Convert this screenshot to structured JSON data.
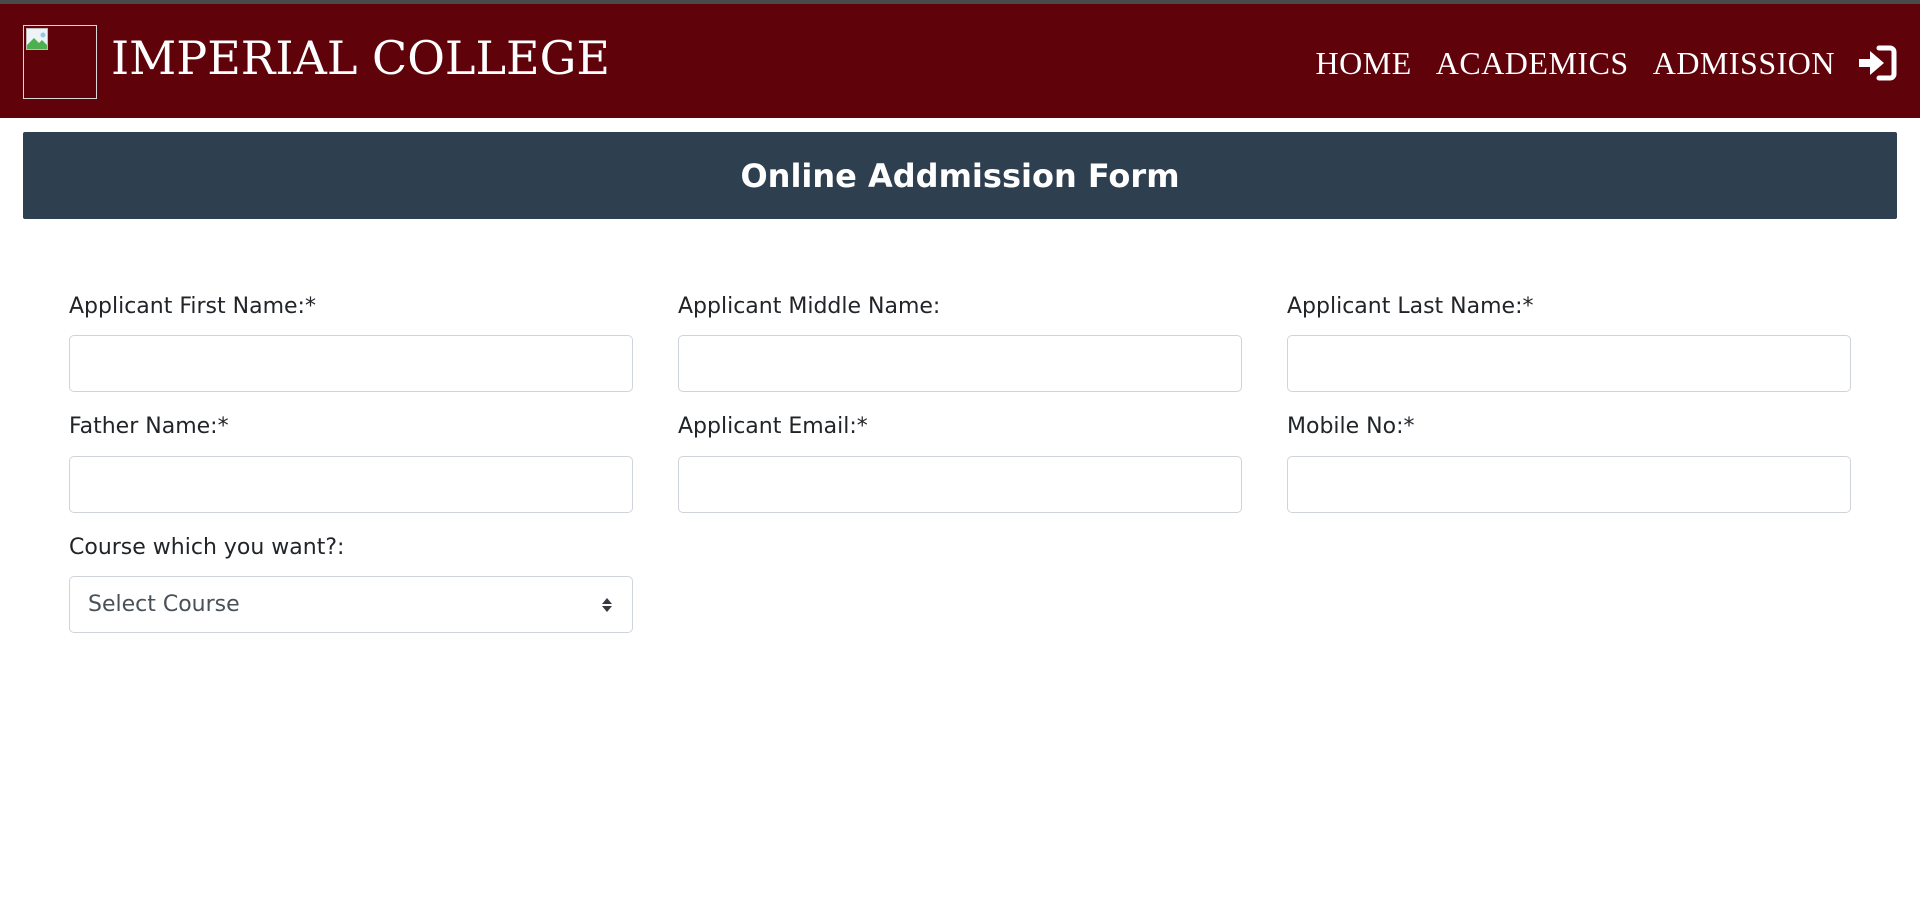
{
  "navbar": {
    "brand": "IMPERIAL COLLEGE",
    "links": [
      "HOME",
      "ACADEMICS",
      "ADMISSION"
    ],
    "login_icon": "sign-in-icon",
    "logo_icon": "broken-image-icon",
    "background": "#5f020a"
  },
  "form": {
    "title": "Online Addmission Form",
    "header_color": "#2e3f50",
    "fields": {
      "first_name": {
        "label": "Applicant First Name:*",
        "value": ""
      },
      "middle_name": {
        "label": "Applicant Middle Name:",
        "value": ""
      },
      "last_name": {
        "label": "Applicant Last Name:*",
        "value": ""
      },
      "father_name": {
        "label": "Father Name:*",
        "value": ""
      },
      "email": {
        "label": "Applicant Email:*",
        "value": ""
      },
      "mobile": {
        "label": "Mobile No:*",
        "value": ""
      },
      "course": {
        "label": "Course which you want?:",
        "selected": "Select Course"
      }
    }
  }
}
